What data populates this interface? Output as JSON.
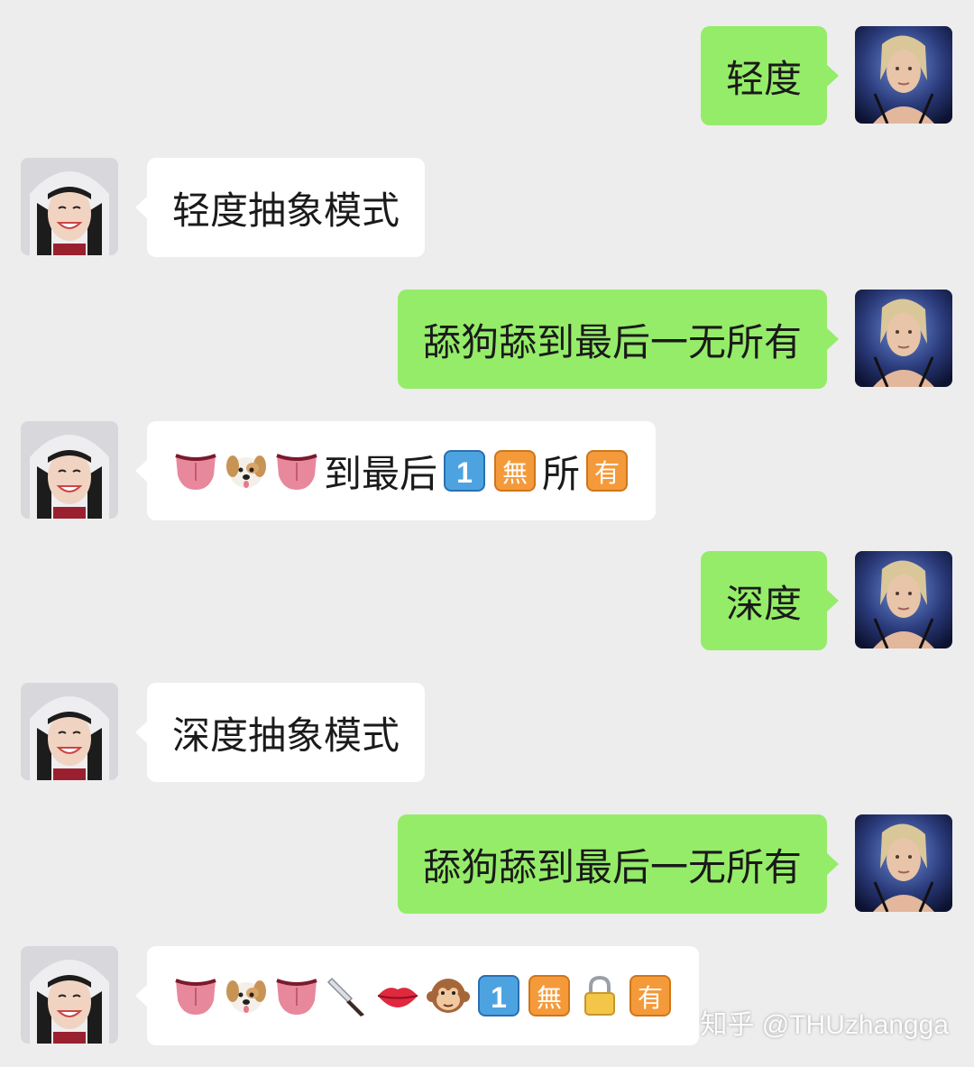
{
  "messages": [
    {
      "side": "right",
      "text": "轻度"
    },
    {
      "side": "left",
      "text": "轻度抽象模式"
    },
    {
      "side": "right",
      "text": "舔狗舔到最后一无所有"
    },
    {
      "side": "left",
      "emoji_sequence": [
        "tongue",
        "dog-face",
        "tongue",
        "到最后",
        "keycap-1",
        "mu-square",
        "所",
        "have-square"
      ]
    },
    {
      "side": "right",
      "text": "深度"
    },
    {
      "side": "left",
      "text": "深度抽象模式"
    },
    {
      "side": "right",
      "text": "舔狗舔到最后一无所有"
    },
    {
      "side": "left",
      "emoji_sequence": [
        "tongue",
        "dog-face",
        "tongue",
        "kitchen-knife",
        "lips",
        "monkey-face",
        "keycap-1",
        "mu-square",
        "lock",
        "have-square"
      ]
    }
  ],
  "emoji_text": {
    "to_end": "到最后",
    "suo": "所",
    "keycap_1": "1",
    "mu": "無",
    "you": "有"
  },
  "watermark": "知乎 @THUzhangga",
  "colors": {
    "background": "#ededed",
    "sent_bubble": "#95ec69",
    "received_bubble": "#ffffff"
  }
}
